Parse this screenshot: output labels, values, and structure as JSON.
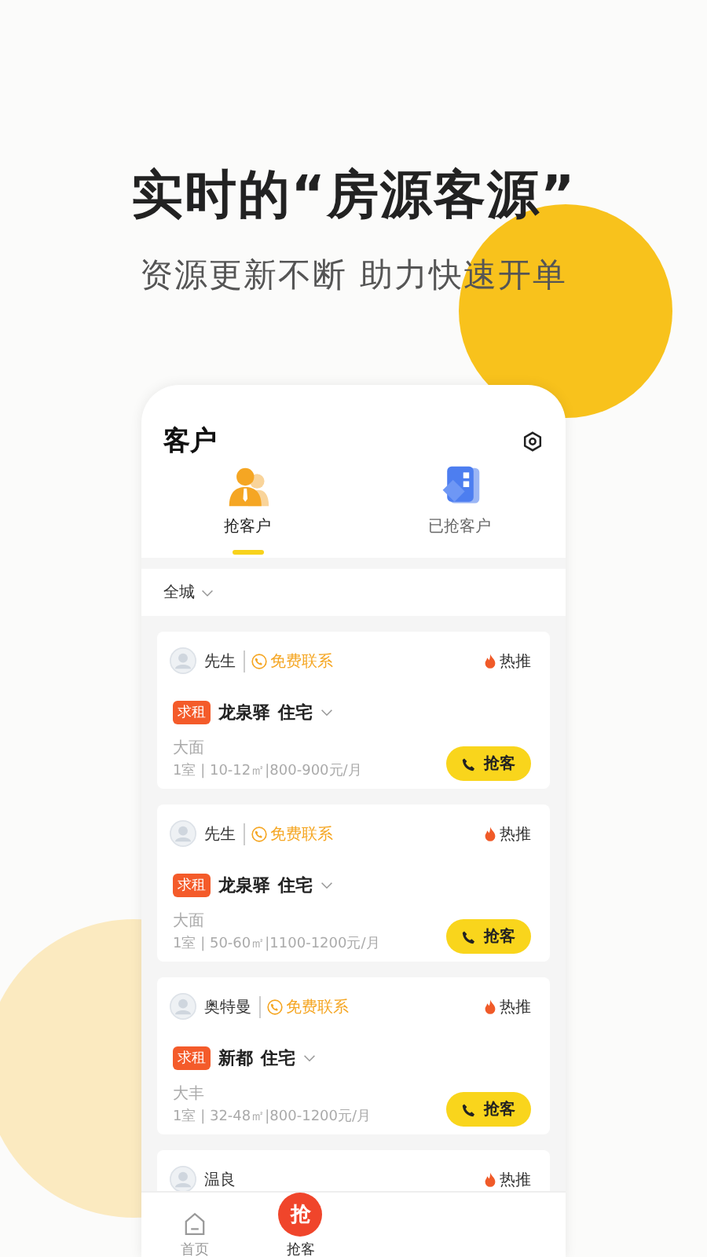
{
  "headline": "实时的“房源客源”",
  "subheadline": "资源更新不断 助力快速开单",
  "screen": {
    "title": "客户",
    "tabs": [
      {
        "label": "抢客户",
        "selected": true,
        "kind": "person"
      },
      {
        "label": "已抢客户",
        "selected": false,
        "kind": "tag"
      }
    ],
    "filter": "全城",
    "cards": [
      {
        "name": "先生",
        "contact": "免费联系",
        "badge": "热推",
        "tag": "求租",
        "title": "龙泉驿",
        "type": "住宅",
        "area": "大面",
        "details": "1室 | 10-12㎡|800-900元/月",
        "action": "抢客"
      },
      {
        "name": "先生",
        "contact": "免费联系",
        "badge": "热推",
        "tag": "求租",
        "title": "龙泉驿",
        "type": "住宅",
        "area": "大面",
        "details": "1室 | 50-60㎡|1100-1200元/月",
        "action": "抢客"
      },
      {
        "name": "奥特曼",
        "contact": "免费联系",
        "badge": "热推",
        "tag": "求租",
        "title": "新都",
        "type": "住宅",
        "area": "大丰",
        "details": "1室 | 32-48㎡|800-1200元/月",
        "action": "抢客"
      },
      {
        "name": "温良",
        "badge": "热推"
      }
    ],
    "nav": [
      {
        "label": "首页",
        "kind": "home",
        "selected": false
      },
      {
        "label": "抢客",
        "kind": "grab",
        "icon_text": "抢",
        "selected": true
      }
    ]
  }
}
